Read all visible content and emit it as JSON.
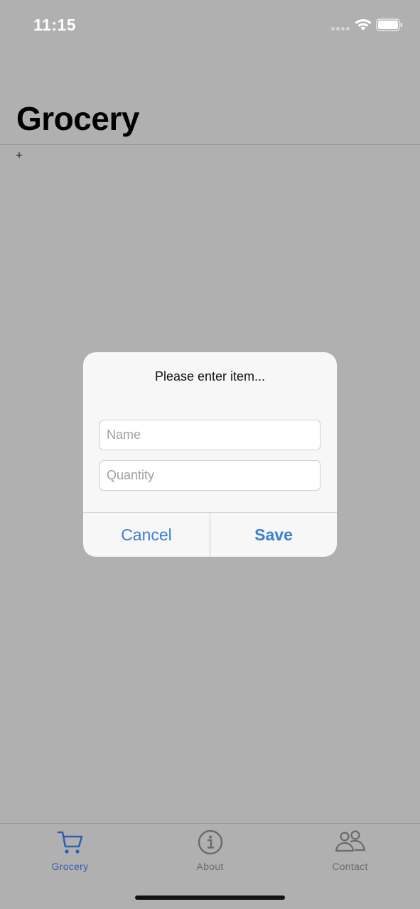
{
  "status_bar": {
    "time": "11:15",
    "signal_icon": "signal-dots-icon",
    "wifi_icon": "wifi-icon",
    "battery_icon": "battery-icon"
  },
  "header": {
    "title": "Grocery",
    "add_label": "+"
  },
  "dialog": {
    "message": "Please enter item...",
    "name_placeholder": "Name",
    "name_value": "",
    "quantity_placeholder": "Quantity",
    "quantity_value": "",
    "cancel_label": "Cancel",
    "save_label": "Save"
  },
  "tab_bar": {
    "tabs": [
      {
        "label": "Grocery",
        "icon": "cart-icon",
        "active": true
      },
      {
        "label": "About",
        "icon": "info-icon",
        "active": false
      },
      {
        "label": "Contact",
        "icon": "contacts-icon",
        "active": false
      }
    ]
  },
  "colors": {
    "accent": "#3b7fd4",
    "active_tab": "#2f5fb0",
    "inactive_tab": "#6a6a6a",
    "backdrop": "#b0b0b0"
  }
}
